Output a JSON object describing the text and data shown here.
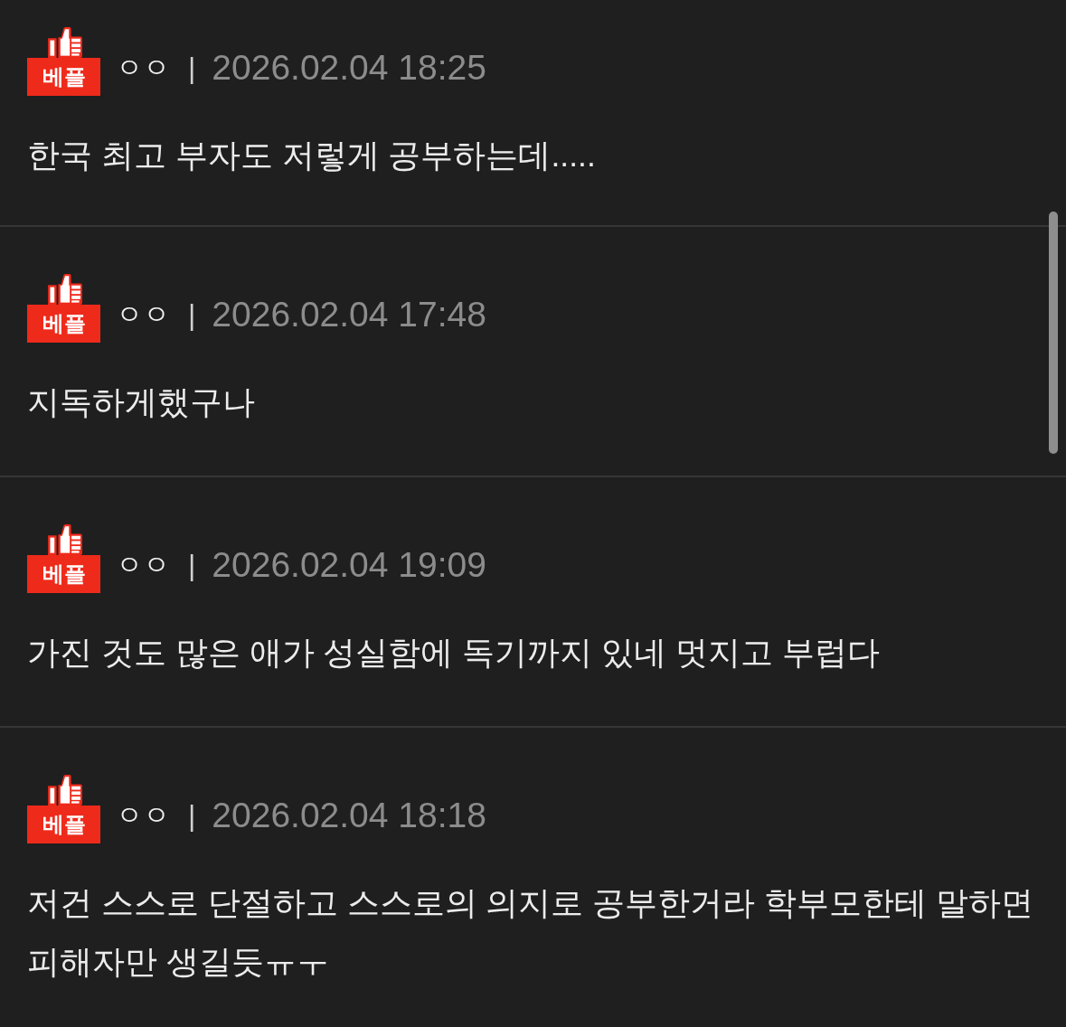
{
  "comments": [
    {
      "badge": "베플",
      "author": "ㅇㅇ",
      "separator": "|",
      "date": "2026.02.04 18:25",
      "text": "한국 최고 부자도 저렇게 공부하는데....."
    },
    {
      "badge": "베플",
      "author": "ㅇㅇ",
      "separator": "|",
      "date": "2026.02.04 17:48",
      "text": "지독하게했구나"
    },
    {
      "badge": "베플",
      "author": "ㅇㅇ",
      "separator": "|",
      "date": "2026.02.04 19:09",
      "text": "가진 것도 많은 애가 성실함에 독기까지 있네 멋지고 부럽다"
    },
    {
      "badge": "베플",
      "author": "ㅇㅇ",
      "separator": "|",
      "date": "2026.02.04 18:18",
      "text": "저건 스스로 단절하고 스스로의 의지로 공부한거라 학부모한테 말하면 피해자만 생길듯ㅠㅜ"
    }
  ]
}
